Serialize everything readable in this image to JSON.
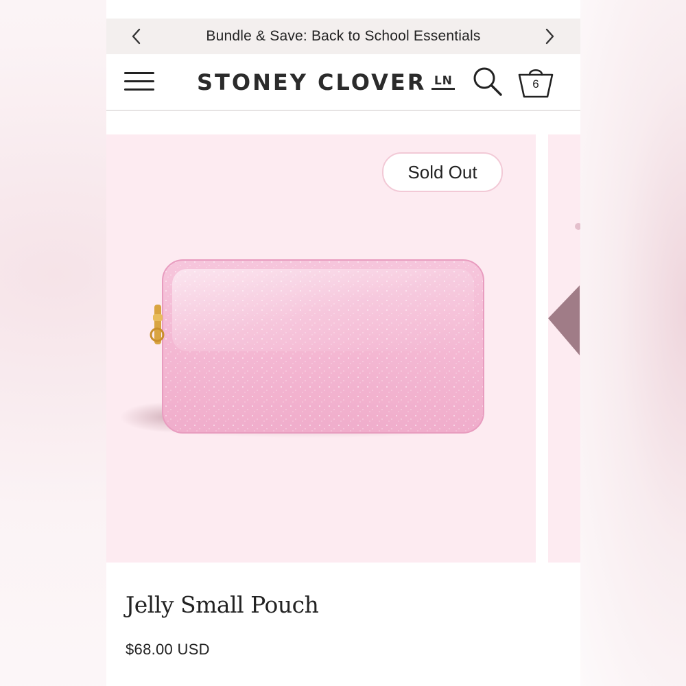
{
  "promo": {
    "text": "Bundle & Save: Back to School Essentials",
    "prev_icon": "chevron-left-icon",
    "next_icon": "chevron-right-icon"
  },
  "header": {
    "logo_text": "STONEY CLOVER",
    "logo_mark": "LN",
    "menu_icon": "hamburger-menu-icon",
    "search_icon": "search-icon",
    "cart_icon": "shopping-bag-icon",
    "cart_count": "6"
  },
  "product": {
    "badge": "Sold Out",
    "title": "Jelly Small Pouch",
    "price": "$68.00 USD",
    "image": "pink-glitter-pouch-image"
  },
  "colors": {
    "image_bg": "#fdebf1",
    "pouch_pink": "#f4b6d2",
    "zipper_gold": "#d9a441",
    "badge_border": "#f2c9d6",
    "promo_bg": "#f3efee"
  }
}
